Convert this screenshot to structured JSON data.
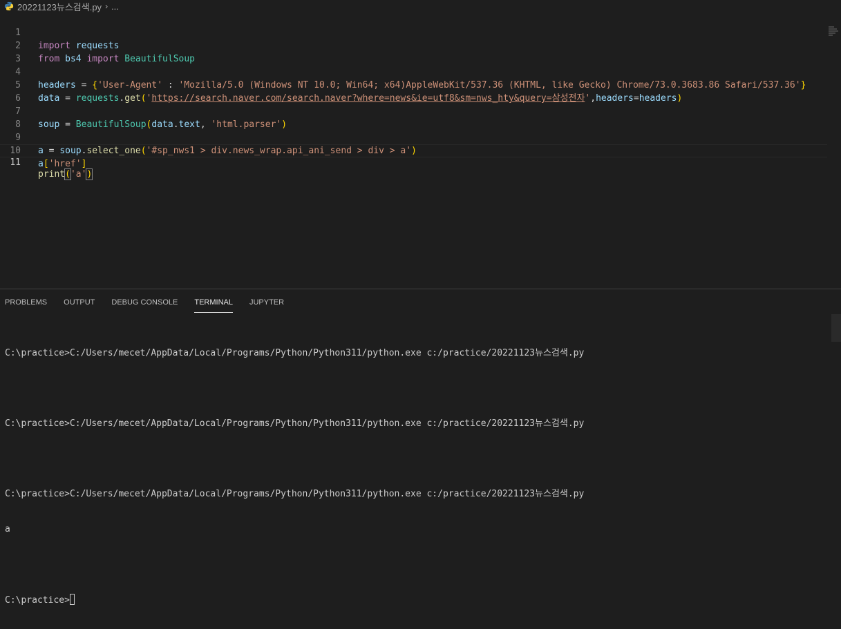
{
  "breadcrumb": {
    "file": "20221123뉴스검색.py",
    "more": "..."
  },
  "editor": {
    "line_numbers": [
      "1",
      "2",
      "3",
      "4",
      "5",
      "6",
      "7",
      "8",
      "9",
      "10",
      "11"
    ],
    "lines": {
      "l1": [
        "import",
        " requests"
      ],
      "l2": [
        "from",
        " bs4 ",
        "import",
        " BeautifulSoup"
      ],
      "l4": [
        "headers",
        " = ",
        "{",
        "'User-Agent'",
        " : ",
        "'Mozilla/5.0 (Windows NT 10.0; Win64; x64)AppleWebKit/537.36 (KHTML, like Gecko) Chrome/73.0.3683.86 Safari/537.36'",
        "}"
      ],
      "l5": [
        "data",
        " = ",
        "requests",
        ".",
        "get",
        "(",
        "'",
        "https://search.naver.com/search.naver?where=news&ie=utf8&sm=nws_hty&query=삼성전자",
        "'",
        ",",
        "headers",
        "=",
        "headers",
        ")"
      ],
      "l7": [
        "soup",
        " = ",
        "BeautifulSoup",
        "(",
        "data",
        ".",
        "text",
        ", ",
        "'html.parser'",
        ")"
      ],
      "l9": [
        "a",
        " = ",
        "soup",
        ".",
        "select_one",
        "(",
        "'#sp_nws1 > div.news_wrap.api_ani_send > div > a'",
        ")"
      ],
      "l10": [
        "a",
        "[",
        "'href'",
        "]"
      ],
      "l11": [
        "print",
        "(",
        "'a'",
        ")"
      ]
    }
  },
  "panel": {
    "tabs": [
      "PROBLEMS",
      "OUTPUT",
      "DEBUG CONSOLE",
      "TERMINAL",
      "JUPYTER"
    ],
    "terminal_lines": [
      "C:\\practice>C:/Users/mecet/AppData/Local/Programs/Python/Python311/python.exe c:/practice/20221123뉴스검색.py",
      "",
      "C:\\practice>C:/Users/mecet/AppData/Local/Programs/Python/Python311/python.exe c:/practice/20221123뉴스검색.py",
      "",
      "C:\\practice>C:/Users/mecet/AppData/Local/Programs/Python/Python311/python.exe c:/practice/20221123뉴스검색.py",
      "a",
      "",
      "C:\\practice>"
    ]
  }
}
